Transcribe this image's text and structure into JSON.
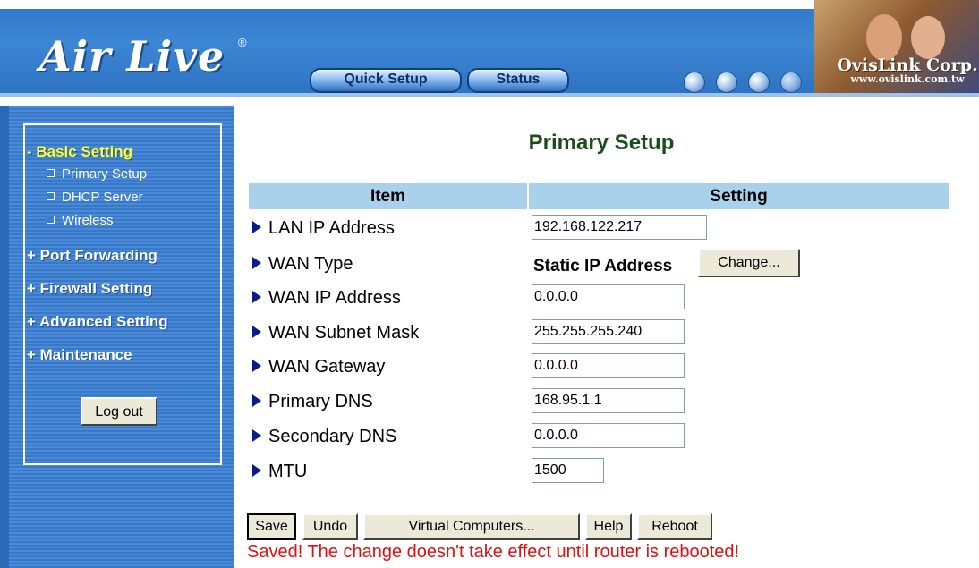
{
  "header": {
    "logo_text": "Air Live",
    "logo_mark": "®",
    "nav": [
      "Quick Setup",
      "Status"
    ],
    "corp_name": "OvisLink Corp.",
    "corp_url": "www.ovislink.com.tw"
  },
  "sidebar": {
    "sections": [
      {
        "label": "- Basic Setting",
        "active": true
      },
      {
        "label": "+ Port Forwarding"
      },
      {
        "label": "+ Firewall Setting"
      },
      {
        "label": "+ Advanced Setting"
      },
      {
        "label": "+ Maintenance"
      }
    ],
    "subitems": [
      "Primary Setup",
      "DHCP Server",
      "Wireless"
    ],
    "logout": "Log out"
  },
  "main": {
    "title": "Primary Setup",
    "columns": [
      "Item",
      "Setting"
    ],
    "rows": [
      {
        "label": "LAN IP Address",
        "value": "192.168.122.217"
      },
      {
        "label": "WAN Type",
        "value": "Static IP Address"
      },
      {
        "label": "WAN IP Address",
        "value": "0.0.0.0"
      },
      {
        "label": "WAN Subnet Mask",
        "value": "255.255.255.240"
      },
      {
        "label": "WAN Gateway",
        "value": "0.0.0.0"
      },
      {
        "label": "Primary DNS",
        "value": "168.95.1.1"
      },
      {
        "label": "Secondary DNS",
        "value": "0.0.0.0"
      },
      {
        "label": "MTU",
        "value": "1500"
      }
    ],
    "change_button": "Change...",
    "buttons": [
      "Save",
      "Undo",
      "Virtual Computers...",
      "Help",
      "Reboot"
    ],
    "message": "Saved! The change doesn't take effect until router is rebooted!"
  },
  "colors": {
    "header_blue": "#2f78c8",
    "table_header": "#a9d1ec",
    "active_section": "#ffff33",
    "title_green": "#1b4d1b",
    "message_red": "#dd1111"
  }
}
